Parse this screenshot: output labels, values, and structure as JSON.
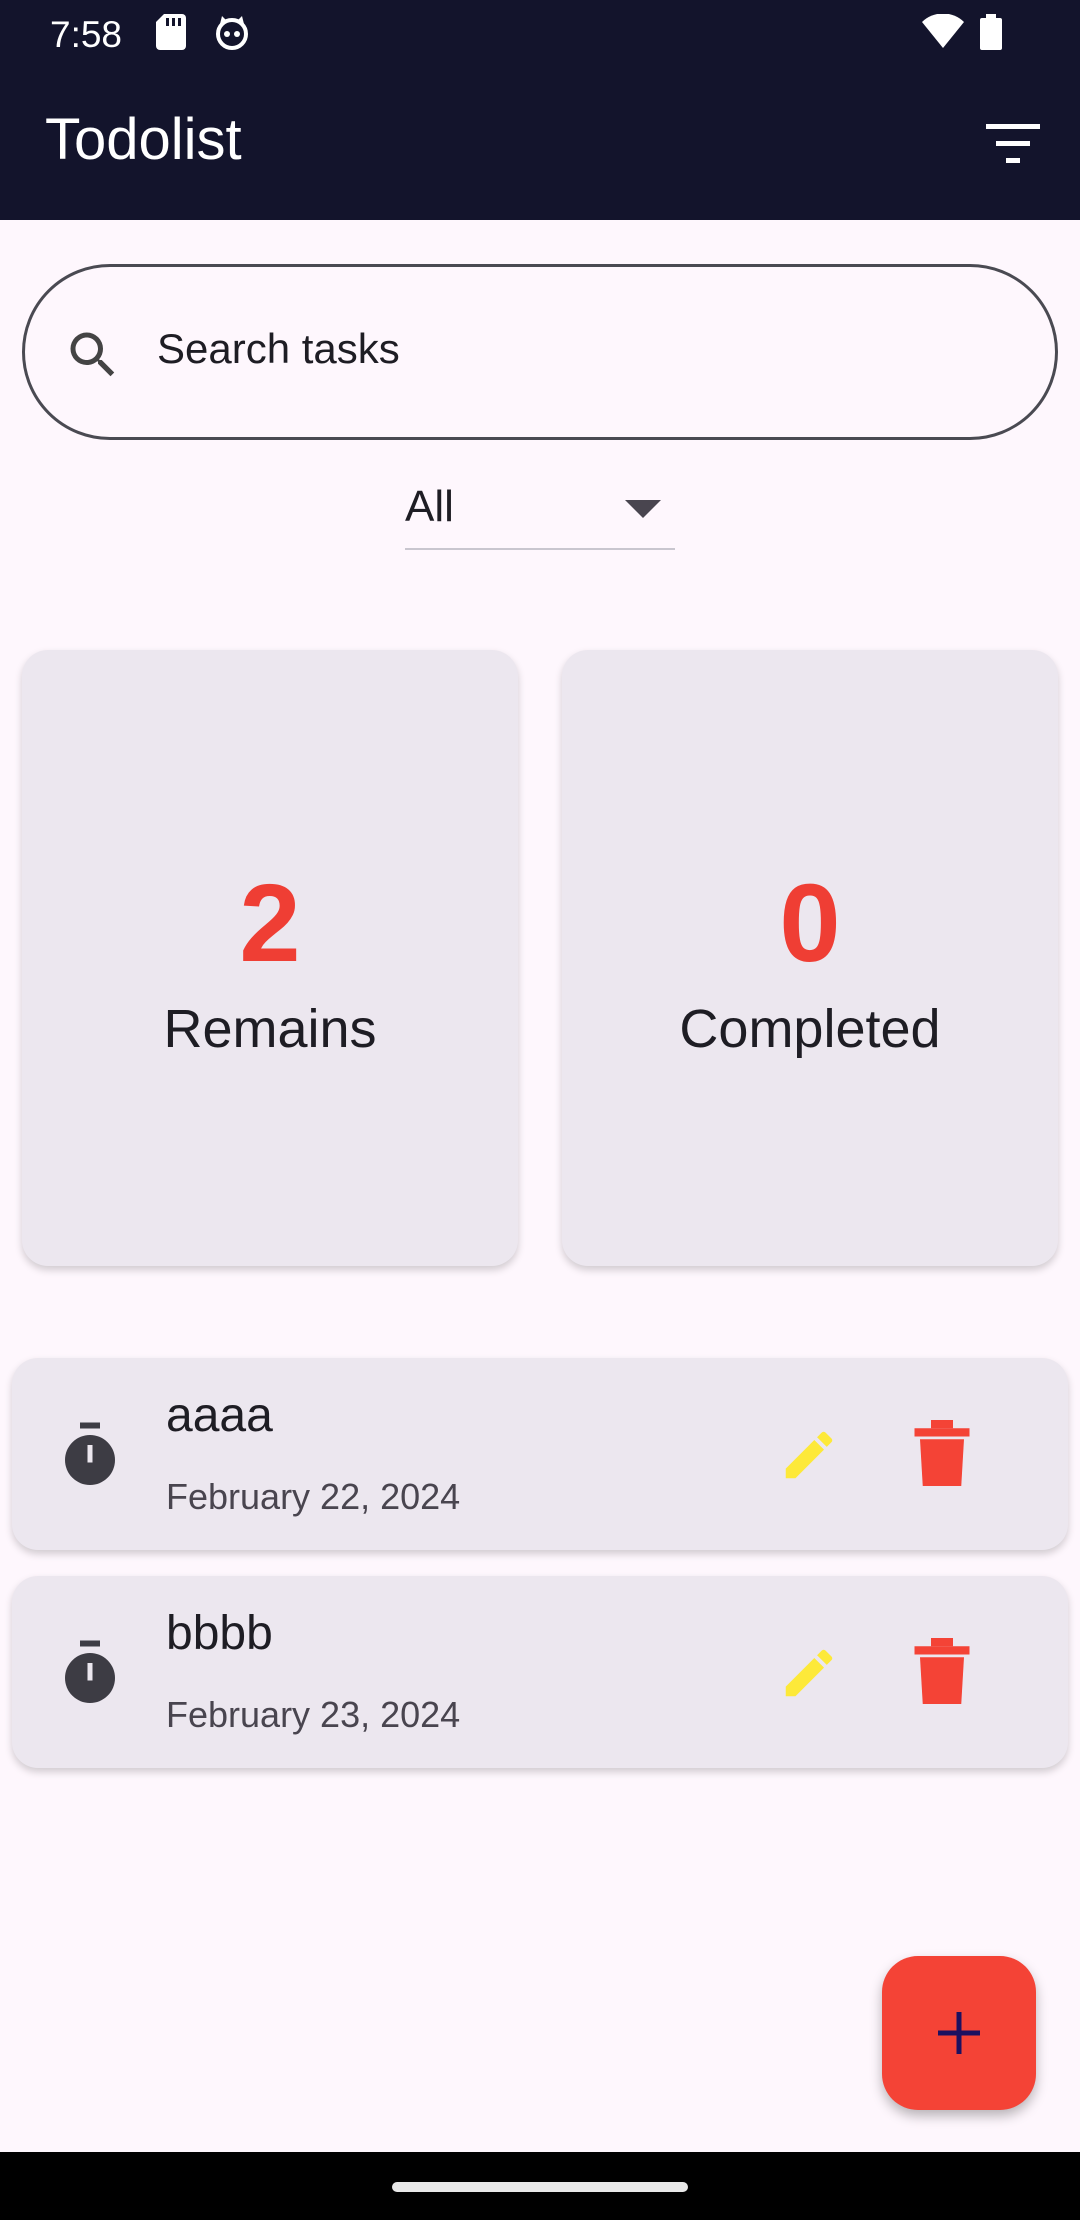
{
  "status_bar": {
    "time": "7:58",
    "icons": [
      "sd-card-icon",
      "cat-face-icon",
      "wifi-icon",
      "battery-icon"
    ]
  },
  "app_bar": {
    "title": "Todolist",
    "filter_icon": "filter-list-icon"
  },
  "search": {
    "placeholder": "Search tasks",
    "icon": "search-icon"
  },
  "filter_dropdown": {
    "selected": "All"
  },
  "stats": {
    "remains": {
      "value": "2",
      "label": "Remains"
    },
    "completed": {
      "value": "0",
      "label": "Completed"
    }
  },
  "tasks": [
    {
      "title": "aaaa",
      "date": "February 22, 2024"
    },
    {
      "title": "bbbb",
      "date": "February 23, 2024"
    }
  ],
  "fab": {
    "icon": "plus-icon"
  },
  "colors": {
    "app_bar": "#13142c",
    "accent_red": "#f44336",
    "stat_number": "#ef3e34",
    "edit_yellow": "#fde939",
    "card_bg": "#ece7ef",
    "page_bg": "#fef7fd"
  }
}
